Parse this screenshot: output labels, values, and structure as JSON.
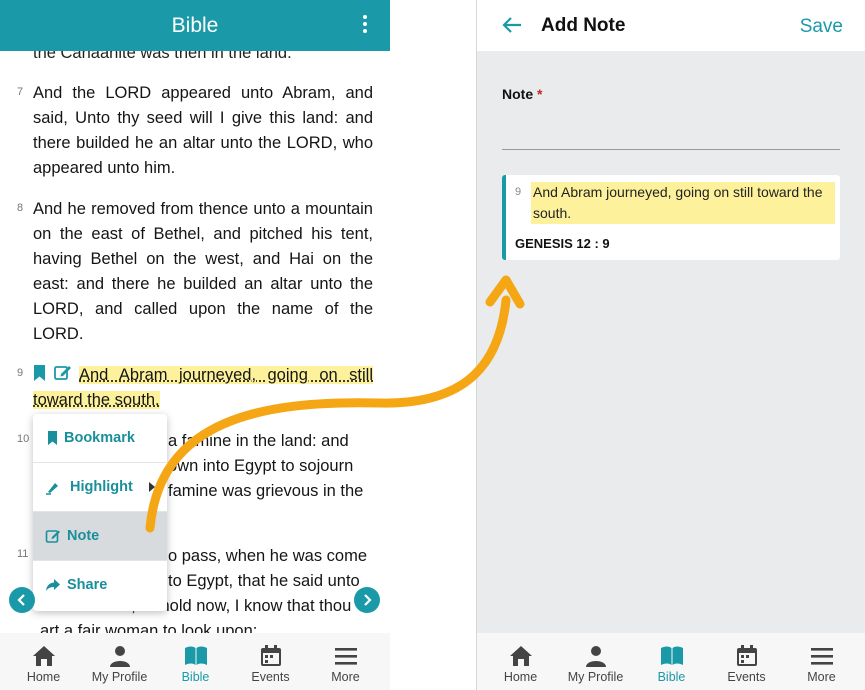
{
  "left": {
    "app_title": "Bible",
    "cut_top_text": "the Canaanite was then in the land.",
    "verses": [
      {
        "num": "7",
        "text": "And the LORD appeared unto Abram, and said, Unto thy seed will I give this land: and there builded he an altar unto the LORD, who appeared unto him."
      },
      {
        "num": "8",
        "text": "And he removed from thence unto a mountain on the east of Bethel, and pitched his tent, having Bethel on the west, and Hai on the east: and there he builded an altar unto the LORD, and called upon the name of the LORD."
      },
      {
        "num": "9",
        "text": "And Abram journeyed, going on still toward the south."
      },
      {
        "num": "10",
        "text1": "a famine in the land: and",
        "text2": "own into Egypt to sojourn",
        "text3": "famine was grievous in the"
      },
      {
        "num": "11",
        "text1": "o pass, when he was come",
        "text2": "to Egypt, that he said unto",
        "text3": "Sarai his wife, Behold now, I know that thou",
        "text4": "art a fair woman to look upon:"
      }
    ],
    "menu": {
      "bookmark": "Bookmark",
      "highlight": "Highlight",
      "note": "Note",
      "share": "Share"
    }
  },
  "bottom_nav": [
    {
      "label": "Home",
      "icon": "home-icon"
    },
    {
      "label": "My Profile",
      "icon": "person-icon"
    },
    {
      "label": "Bible",
      "icon": "book-icon",
      "active": true
    },
    {
      "label": "Events",
      "icon": "calendar-icon"
    },
    {
      "label": "More",
      "icon": "menu-icon"
    }
  ],
  "right": {
    "title": "Add Note",
    "save_label": "Save",
    "note_label": "Note",
    "required_mark": "*",
    "note_value": "",
    "card": {
      "verse_num": "9",
      "verse_text": "And Abram journeyed, going on still toward the south.",
      "reference": "GENESIS 12 : 9"
    }
  },
  "colors": {
    "accent": "#1a9aa8",
    "highlight": "#fdf29b",
    "arrow": "#f5a614"
  }
}
